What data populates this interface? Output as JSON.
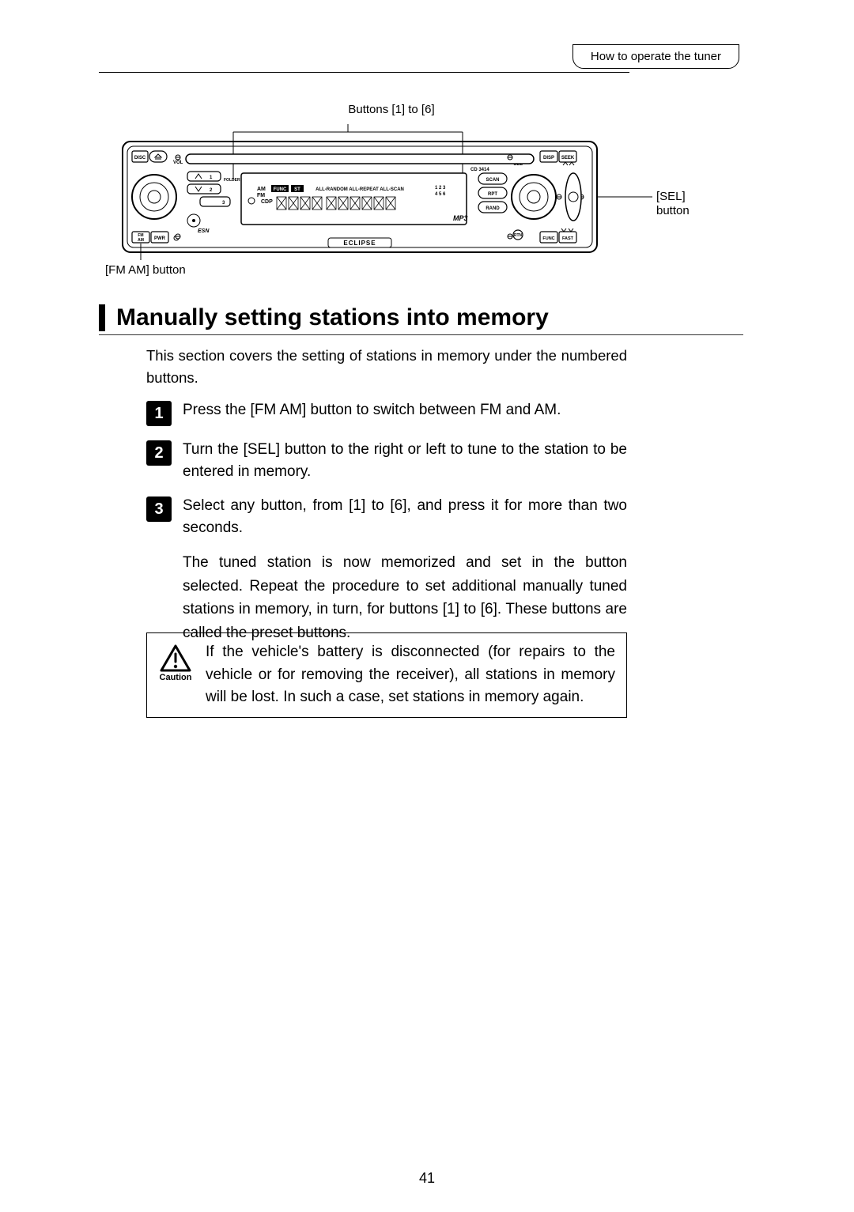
{
  "header": {
    "tab_label": "How to operate the tuner"
  },
  "diagram": {
    "top_caption": "Buttons [1] to [6]",
    "left_caption": "[FM AM] button",
    "right_caption_line1": "[SEL]",
    "right_caption_line2": "button",
    "brand": "ECLIPSE",
    "device_labels": {
      "disc": "DISC",
      "vol": "VOL",
      "folder": "FOLDER",
      "fm_am": "FM AM",
      "pwr": "PWR",
      "esn": "ESN",
      "disp": "DISP",
      "seek": "SEEK",
      "sel": "SEL",
      "scan": "SCAN",
      "rpt": "RPT",
      "rand": "RAND",
      "rtn": "RTN",
      "func": "FUNC",
      "fast": "FAST",
      "am_fm": "AM FM",
      "cdp": "CDP",
      "cd": "CD 3414",
      "mp3": "MP3",
      "display_text": "ALL-RANDOM ALL-REPEAT ALL-SCAN",
      "preset_numbers": "1 2 3 4 5 6",
      "tune1": "1",
      "tune2": "2",
      "tune3": "3"
    }
  },
  "section": {
    "title": "Manually setting stations into memory",
    "intro": "This section covers the setting of stations in memory under the numbered buttons.",
    "steps": [
      {
        "n": "1",
        "text": "Press the [FM AM] button to switch between FM and AM."
      },
      {
        "n": "2",
        "text": "Turn the [SEL] button to the right or left to tune to the station to be entered in memory."
      },
      {
        "n": "3",
        "text": "Select any button, from [1] to [6], and press it for more than two seconds."
      }
    ],
    "step3_body": "The tuned station is now memorized and set in the button selected. Repeat the procedure to set additional manually tuned stations in memory, in turn, for buttons [1] to [6]. These buttons are called the preset buttons."
  },
  "caution": {
    "label": "Caution",
    "text": "If the vehicle's battery is disconnected (for repairs to the vehicle or for removing the receiver), all stations in memory will be lost. In such a case, set stations in memory again."
  },
  "page_number": "41"
}
